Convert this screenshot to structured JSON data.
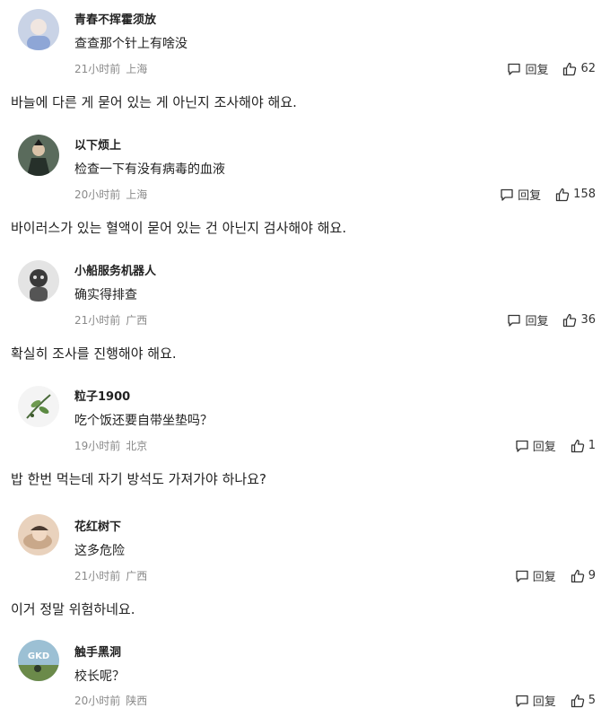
{
  "comments": [
    {
      "username": "青春不挥霍须放",
      "text": "查查那个针上有啥没",
      "time": "21小时前",
      "location": "上海",
      "reply_label": "回复",
      "likes": "62",
      "translation": "바늘에 다른 게 묻어 있는 게 아닌지 조사해야 해요.",
      "avatar_color": "#c9d3e6"
    },
    {
      "username": "以下烦上",
      "text": "检查一下有没有病毒的血液",
      "time": "20小时前",
      "location": "上海",
      "reply_label": "回复",
      "likes": "158",
      "translation": "바이러스가 있는 혈액이 묻어 있는 건 아닌지 검사해야 해요.",
      "avatar_color": "#3a4a3c"
    },
    {
      "username": "小船服务机器人",
      "text": "确实得排查",
      "time": "21小时前",
      "location": "广西",
      "reply_label": "回复",
      "likes": "36",
      "translation": "확실히 조사를 진행해야 해요.",
      "avatar_color": "#dcdcdc"
    },
    {
      "username": "粒子1900",
      "text": "吃个饭还要自带坐垫吗？",
      "time": "19小时前",
      "location": "北京",
      "reply_label": "回复",
      "likes": "1",
      "translation": "밥 한번 먹는데 자기 방석도 가져가야 하나요?",
      "avatar_color": "#f2f2f2"
    },
    {
      "username": "花红树下",
      "text": "这多危险",
      "time": "21小时前",
      "location": "广西",
      "reply_label": "回复",
      "likes": "9",
      "translation": "이거 정말 위험하네요.",
      "avatar_color": "#e8cdb5"
    },
    {
      "username": "触手黑洞",
      "text": "校长呢？",
      "time": "20小时前",
      "location": "陕西",
      "reply_label": "回复",
      "likes": "5",
      "translation": "",
      "avatar_color": "#8fb3c7",
      "avatar_text": "GKD"
    }
  ]
}
